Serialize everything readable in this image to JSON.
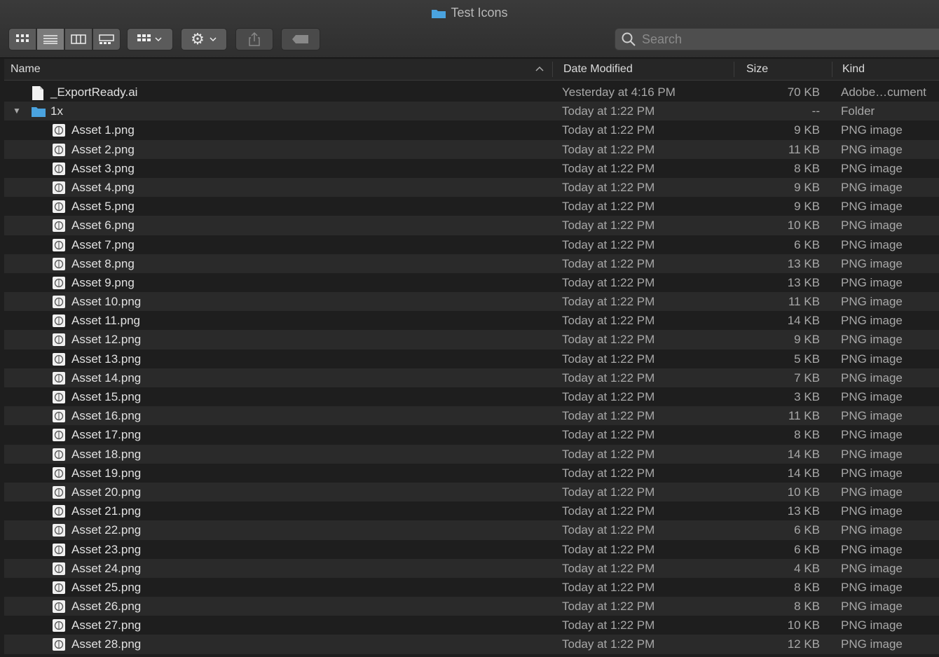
{
  "window": {
    "title": "Test Icons"
  },
  "search": {
    "placeholder": "Search"
  },
  "columns": {
    "name": "Name",
    "date": "Date Modified",
    "size": "Size",
    "kind": "Kind"
  },
  "files": [
    {
      "name": "_ExportReady.ai",
      "date": "Yesterday at 4:16 PM",
      "size": "70 KB",
      "kind": "Adobe…cument",
      "icon": "ai-document-icon",
      "level": 0
    },
    {
      "name": "1x",
      "date": "Today at 1:22 PM",
      "size": "--",
      "kind": "Folder",
      "icon": "folder-icon",
      "level": 0,
      "expanded": true
    },
    {
      "name": "Asset 1.png",
      "date": "Today at 1:22 PM",
      "size": "9 KB",
      "kind": "PNG image",
      "icon": "png-thumb-icon",
      "level": 1
    },
    {
      "name": "Asset 2.png",
      "date": "Today at 1:22 PM",
      "size": "11 KB",
      "kind": "PNG image",
      "icon": "png-thumb-icon",
      "level": 1
    },
    {
      "name": "Asset 3.png",
      "date": "Today at 1:22 PM",
      "size": "8 KB",
      "kind": "PNG image",
      "icon": "png-thumb-icon",
      "level": 1
    },
    {
      "name": "Asset 4.png",
      "date": "Today at 1:22 PM",
      "size": "9 KB",
      "kind": "PNG image",
      "icon": "png-thumb-icon",
      "level": 1
    },
    {
      "name": "Asset 5.png",
      "date": "Today at 1:22 PM",
      "size": "9 KB",
      "kind": "PNG image",
      "icon": "png-thumb-icon",
      "level": 1
    },
    {
      "name": "Asset 6.png",
      "date": "Today at 1:22 PM",
      "size": "10 KB",
      "kind": "PNG image",
      "icon": "png-thumb-icon",
      "level": 1
    },
    {
      "name": "Asset 7.png",
      "date": "Today at 1:22 PM",
      "size": "6 KB",
      "kind": "PNG image",
      "icon": "png-thumb-icon",
      "level": 1
    },
    {
      "name": "Asset 8.png",
      "date": "Today at 1:22 PM",
      "size": "13 KB",
      "kind": "PNG image",
      "icon": "png-thumb-icon",
      "level": 1
    },
    {
      "name": "Asset 9.png",
      "date": "Today at 1:22 PM",
      "size": "13 KB",
      "kind": "PNG image",
      "icon": "png-thumb-icon",
      "level": 1
    },
    {
      "name": "Asset 10.png",
      "date": "Today at 1:22 PM",
      "size": "11 KB",
      "kind": "PNG image",
      "icon": "png-thumb-icon",
      "level": 1
    },
    {
      "name": "Asset 11.png",
      "date": "Today at 1:22 PM",
      "size": "14 KB",
      "kind": "PNG image",
      "icon": "png-thumb-icon",
      "level": 1
    },
    {
      "name": "Asset 12.png",
      "date": "Today at 1:22 PM",
      "size": "9 KB",
      "kind": "PNG image",
      "icon": "png-thumb-icon",
      "level": 1
    },
    {
      "name": "Asset 13.png",
      "date": "Today at 1:22 PM",
      "size": "5 KB",
      "kind": "PNG image",
      "icon": "png-thumb-icon",
      "level": 1
    },
    {
      "name": "Asset 14.png",
      "date": "Today at 1:22 PM",
      "size": "7 KB",
      "kind": "PNG image",
      "icon": "png-thumb-icon",
      "level": 1
    },
    {
      "name": "Asset 15.png",
      "date": "Today at 1:22 PM",
      "size": "3 KB",
      "kind": "PNG image",
      "icon": "png-thumb-icon",
      "level": 1
    },
    {
      "name": "Asset 16.png",
      "date": "Today at 1:22 PM",
      "size": "11 KB",
      "kind": "PNG image",
      "icon": "png-thumb-icon",
      "level": 1
    },
    {
      "name": "Asset 17.png",
      "date": "Today at 1:22 PM",
      "size": "8 KB",
      "kind": "PNG image",
      "icon": "png-thumb-icon",
      "level": 1
    },
    {
      "name": "Asset 18.png",
      "date": "Today at 1:22 PM",
      "size": "14 KB",
      "kind": "PNG image",
      "icon": "png-thumb-icon",
      "level": 1
    },
    {
      "name": "Asset 19.png",
      "date": "Today at 1:22 PM",
      "size": "14 KB",
      "kind": "PNG image",
      "icon": "png-thumb-icon",
      "level": 1
    },
    {
      "name": "Asset 20.png",
      "date": "Today at 1:22 PM",
      "size": "10 KB",
      "kind": "PNG image",
      "icon": "png-thumb-icon",
      "level": 1
    },
    {
      "name": "Asset 21.png",
      "date": "Today at 1:22 PM",
      "size": "13 KB",
      "kind": "PNG image",
      "icon": "png-thumb-icon",
      "level": 1
    },
    {
      "name": "Asset 22.png",
      "date": "Today at 1:22 PM",
      "size": "6 KB",
      "kind": "PNG image",
      "icon": "png-thumb-icon",
      "level": 1
    },
    {
      "name": "Asset 23.png",
      "date": "Today at 1:22 PM",
      "size": "6 KB",
      "kind": "PNG image",
      "icon": "png-thumb-icon",
      "level": 1
    },
    {
      "name": "Asset 24.png",
      "date": "Today at 1:22 PM",
      "size": "4 KB",
      "kind": "PNG image",
      "icon": "png-thumb-icon",
      "level": 1
    },
    {
      "name": "Asset 25.png",
      "date": "Today at 1:22 PM",
      "size": "8 KB",
      "kind": "PNG image",
      "icon": "png-thumb-icon",
      "level": 1
    },
    {
      "name": "Asset 26.png",
      "date": "Today at 1:22 PM",
      "size": "8 KB",
      "kind": "PNG image",
      "icon": "png-thumb-icon",
      "level": 1
    },
    {
      "name": "Asset 27.png",
      "date": "Today at 1:22 PM",
      "size": "10 KB",
      "kind": "PNG image",
      "icon": "png-thumb-icon",
      "level": 1
    },
    {
      "name": "Asset 28.png",
      "date": "Today at 1:22 PM",
      "size": "12 KB",
      "kind": "PNG image",
      "icon": "png-thumb-icon",
      "level": 1
    }
  ],
  "colors": {
    "folder": "#4aa3df",
    "background": "#1e1e1e",
    "alt_row": "#2a2a2a"
  }
}
